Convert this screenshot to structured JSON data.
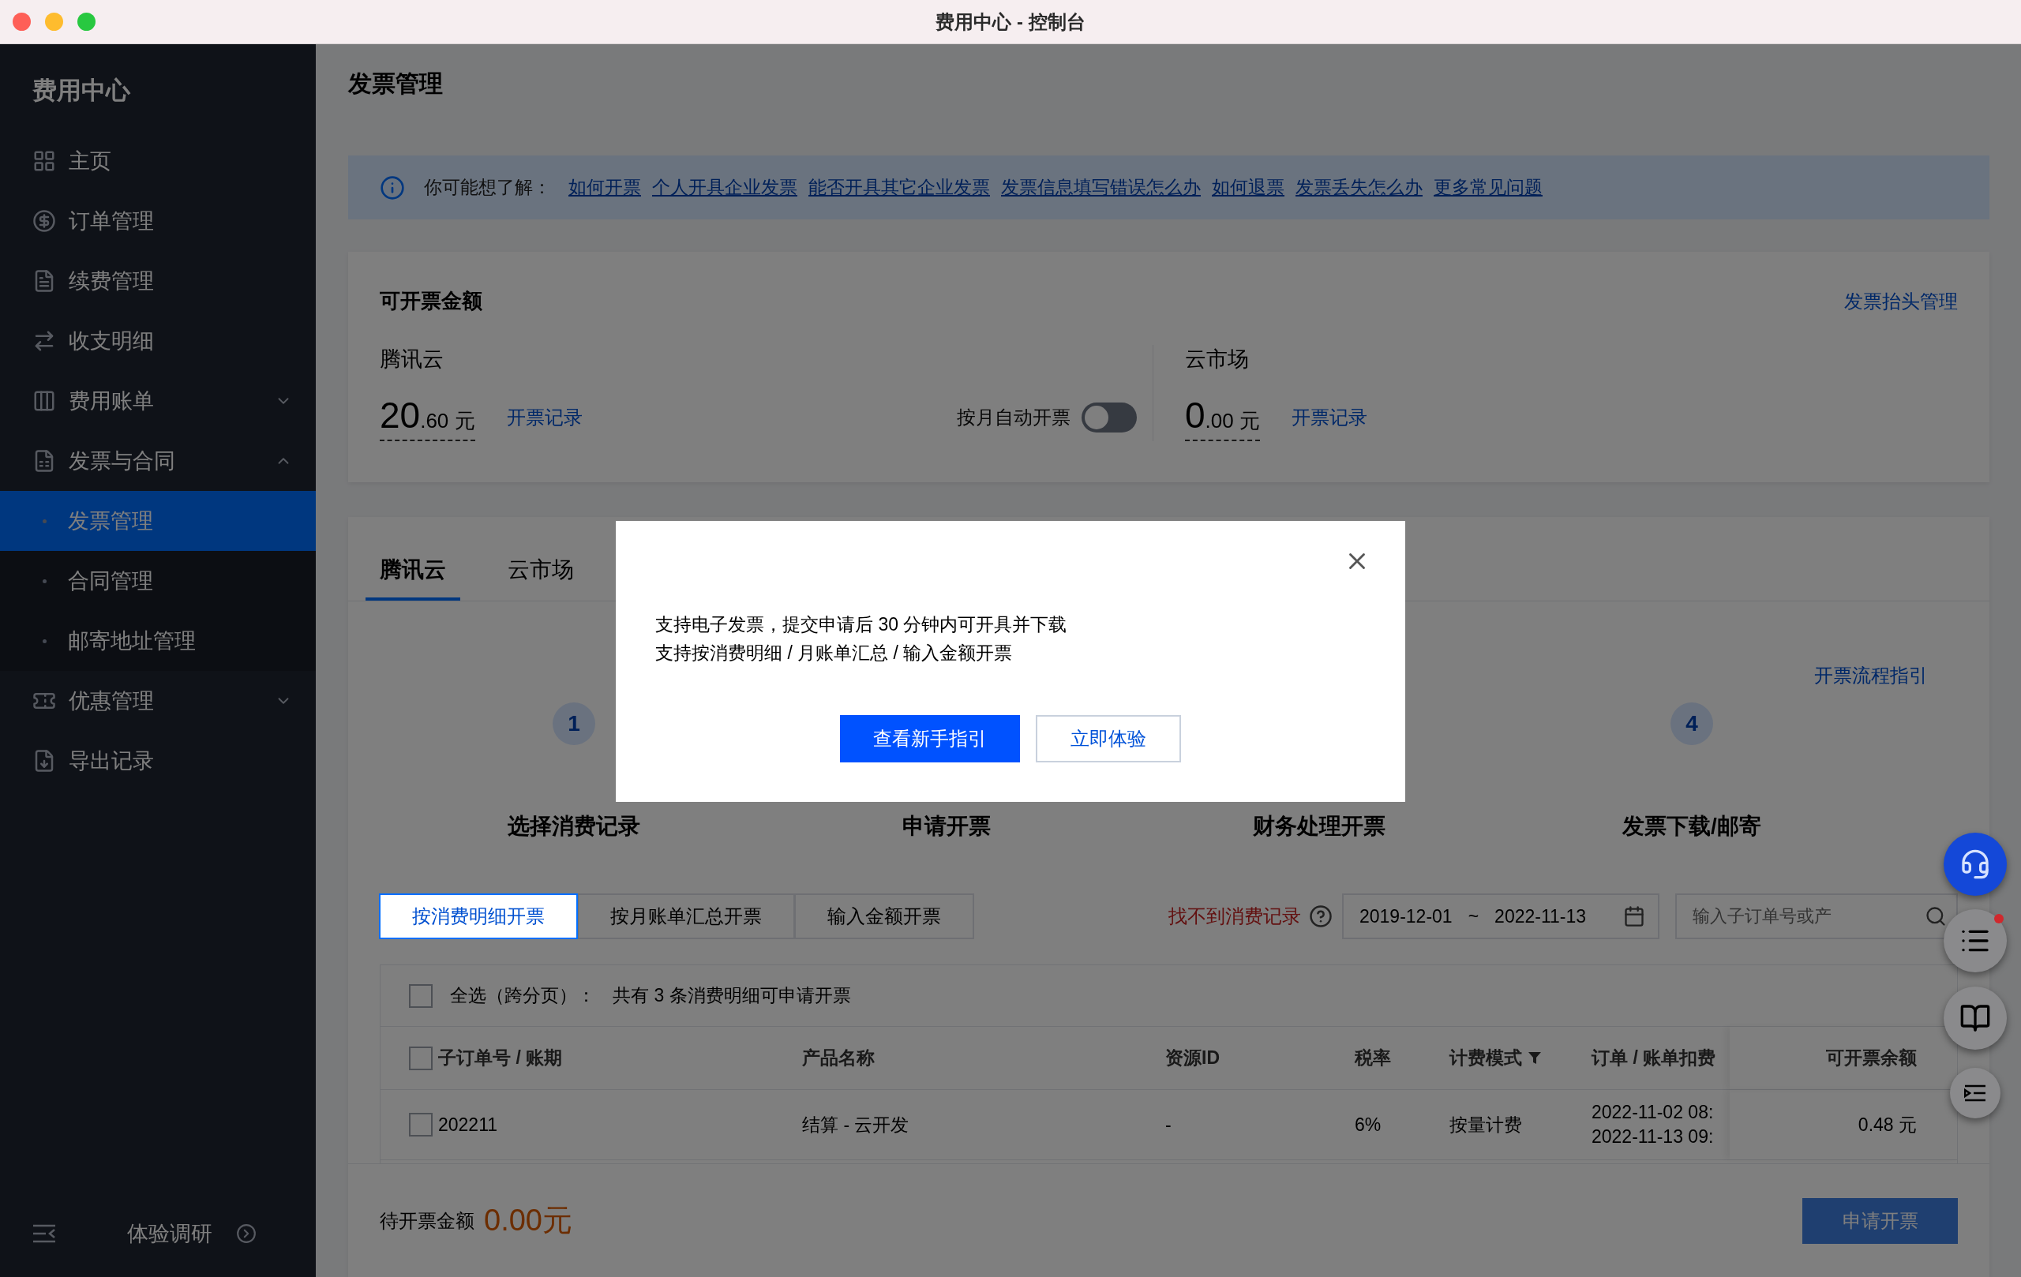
{
  "window": {
    "title": "费用中心 - 控制台"
  },
  "sidebar": {
    "title": "费用中心",
    "items": [
      {
        "label": "主页",
        "selected": false
      },
      {
        "label": "订单管理",
        "selected": false
      },
      {
        "label": "续费管理",
        "selected": false
      },
      {
        "label": "收支明细",
        "selected": false
      },
      {
        "label": "费用账单",
        "selected": false,
        "expanded": false
      },
      {
        "label": "发票与合同",
        "selected": false,
        "expanded": true,
        "children": [
          {
            "label": "发票管理",
            "selected": true
          },
          {
            "label": "合同管理",
            "selected": false
          },
          {
            "label": "邮寄地址管理",
            "selected": false
          }
        ]
      },
      {
        "label": "优惠管理",
        "selected": false,
        "expanded": false
      },
      {
        "label": "导出记录",
        "selected": false
      }
    ],
    "survey": "体验调研"
  },
  "page": {
    "title": "发票管理"
  },
  "notice": {
    "prefix": "你可能想了解：",
    "links": [
      "如何开票",
      "个人开具企业发票",
      "能否开具其它企业发票",
      "发票信息填写错误怎么办",
      "如何退票",
      "发票丢失怎么办",
      "更多常见问题"
    ]
  },
  "amount_card": {
    "title": "可开票金额",
    "link": "发票抬头管理",
    "accounts": [
      {
        "name": "腾讯云",
        "amount": "20.60 元",
        "link": "开票记录",
        "auto_invoice": {
          "label": "按月自动开票",
          "on": false
        }
      },
      {
        "name": "云市场",
        "amount": "0.00 元",
        "link": "开票记录"
      }
    ]
  },
  "invoice_panel": {
    "tabs": [
      {
        "label": "腾讯云",
        "selected": true
      },
      {
        "label": "云市场",
        "selected": false
      }
    ],
    "guide_link": "开票流程指引",
    "steps": [
      {
        "number": "1",
        "label": "选择消费记录"
      },
      {
        "label": "申请开票"
      },
      {
        "label": "财务处理开票"
      },
      {
        "number": "4",
        "label": "发票下载/邮寄"
      }
    ],
    "modes": [
      {
        "label": "按消费明细开票",
        "selected": true
      },
      {
        "label": "按月账单汇总开票",
        "selected": false
      },
      {
        "label": "输入金额开票",
        "selected": false
      }
    ],
    "missing_record": "找不到消费记录",
    "date_range": {
      "start": "2019-12-01",
      "separator": "~",
      "end": "2022-11-13"
    },
    "search": {
      "placeholder": "输入子订单号或产"
    },
    "table": {
      "select_all": {
        "label": "全选（跨分页）：",
        "summary": "共有 3 条消费明细可申请开票",
        "checked": false
      },
      "header_checked": false,
      "columns": [
        {
          "label": "子订单号 / 账期",
          "filter": false
        },
        {
          "label": "产品名称",
          "filter": false
        },
        {
          "label": "资源ID",
          "filter": false
        },
        {
          "label": "税率",
          "filter": false
        },
        {
          "label": "计费模式",
          "filter": true
        },
        {
          "label": "订单 / 账单扣费",
          "filter": false
        },
        {
          "label": "可开票余额",
          "filter": false
        }
      ],
      "rows": [
        {
          "checked": false,
          "cells": [
            "202211",
            "结算 - 云开发",
            "-",
            "6%",
            "按量计费"
          ],
          "deducted_at": [
            "2022-11-02 08:",
            "2022-11-13 09:"
          ],
          "balance": "0.48 元"
        }
      ]
    },
    "footer": {
      "label": "待开票金额",
      "amount": "0.00元",
      "button": {
        "label": "申请开票",
        "disabled": true
      }
    }
  },
  "dialog": {
    "lines": [
      "支持电子发票，提交申请后 30 分钟内可开具并下载",
      "支持按消费明细 / 月账单汇总 / 输入金额开票"
    ],
    "buttons": [
      {
        "label": "查看新手指引",
        "kind": "primary"
      },
      {
        "label": "立即体验",
        "kind": "secondary"
      }
    ]
  }
}
